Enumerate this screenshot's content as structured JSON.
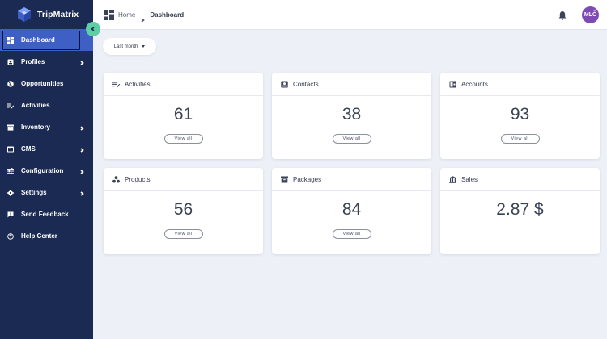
{
  "app": {
    "name": "TripMatrix"
  },
  "sidebar": {
    "items": [
      {
        "label": "Dashboard",
        "icon": "dashboard-icon",
        "active": true,
        "has_children": false
      },
      {
        "label": "Profiles",
        "icon": "profile-icon",
        "active": false,
        "has_children": true
      },
      {
        "label": "Opportunities",
        "icon": "globe-icon",
        "active": false,
        "has_children": false
      },
      {
        "label": "Activities",
        "icon": "activity-list-icon",
        "active": false,
        "has_children": false
      },
      {
        "label": "Inventory",
        "icon": "inventory-icon",
        "active": false,
        "has_children": true
      },
      {
        "label": "CMS",
        "icon": "cms-icon",
        "active": false,
        "has_children": true
      },
      {
        "label": "Configuration",
        "icon": "sliders-icon",
        "active": false,
        "has_children": true
      },
      {
        "label": "Settings",
        "icon": "gear-icon",
        "active": false,
        "has_children": true
      },
      {
        "label": "Send Feedback",
        "icon": "feedback-icon",
        "active": false,
        "has_children": false
      },
      {
        "label": "Help Center",
        "icon": "help-icon",
        "active": false,
        "has_children": false
      }
    ]
  },
  "header": {
    "breadcrumb": {
      "home": "Home",
      "current": "Dashboard"
    },
    "avatar_initials": "MLČ"
  },
  "filter": {
    "label": "Last month"
  },
  "cards": [
    {
      "title": "Activities",
      "value": "61",
      "button": "View all",
      "icon": "activity-list-icon"
    },
    {
      "title": "Contacts",
      "value": "38",
      "button": "View all",
      "icon": "contacts-icon"
    },
    {
      "title": "Accounts",
      "value": "93",
      "button": "View all",
      "icon": "accounts-icon"
    },
    {
      "title": "Products",
      "value": "56",
      "button": "View all",
      "icon": "products-icon"
    },
    {
      "title": "Packages",
      "value": "84",
      "button": "View all",
      "icon": "packages-icon"
    },
    {
      "title": "Sales",
      "value": "2.87 $",
      "icon": "bank-icon"
    }
  ],
  "colors": {
    "sidebar_bg": "#1b2a52",
    "active_item": "#3e5fc4",
    "collapse_button": "#5ecfa5",
    "avatar": "#7e4bb5",
    "page_bg": "#eef0f7"
  }
}
